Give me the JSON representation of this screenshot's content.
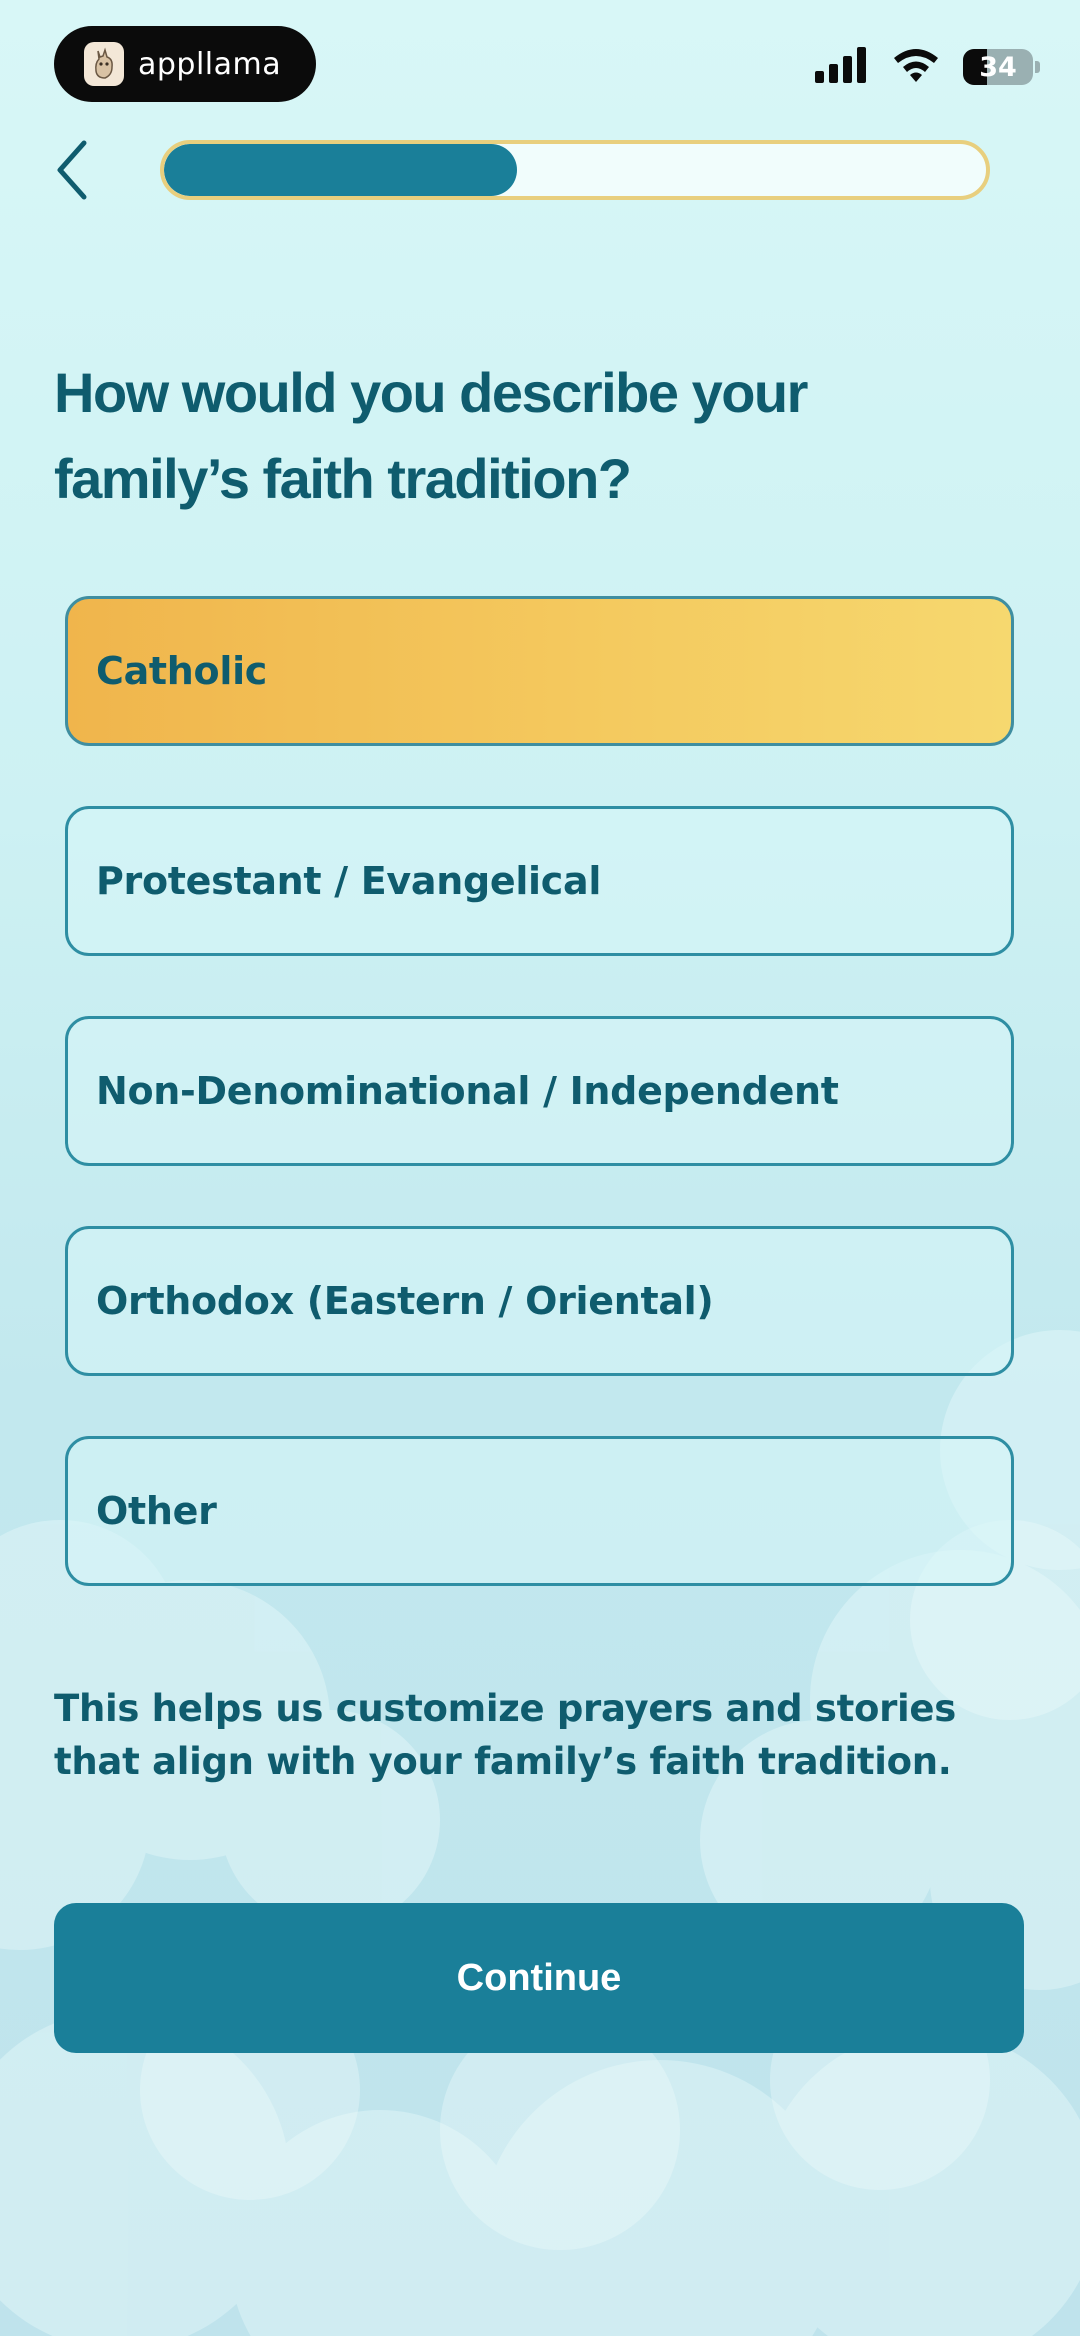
{
  "status_bar": {
    "app_name": "appllama",
    "battery_level": 34,
    "battery_text": "34",
    "icons": [
      "llama-logo-icon",
      "cellular-signal-icon",
      "wifi-icon",
      "battery-icon"
    ]
  },
  "header": {
    "back_icon": "chevron-left-icon",
    "progress_fraction": 0.43
  },
  "question": {
    "title": "How would you describe your family’s faith tradition?"
  },
  "options": [
    {
      "label": "Catholic",
      "selected": true
    },
    {
      "label": "Protestant / Evangelical",
      "selected": false
    },
    {
      "label": "Non-Denominational / Independent",
      "selected": false
    },
    {
      "label": "Orthodox (Eastern / Oriental)",
      "selected": false
    },
    {
      "label": "Other",
      "selected": false
    }
  ],
  "helper_text": "This helps us customize prayers and stories that align with your family’s faith tradition.",
  "continue_label": "Continue",
  "colors": {
    "primary": "#1a7f99",
    "text": "#0f5c6e",
    "selected_start": "#f0b54c",
    "selected_end": "#f6d86f",
    "progress_border": "#e8cf7e"
  }
}
